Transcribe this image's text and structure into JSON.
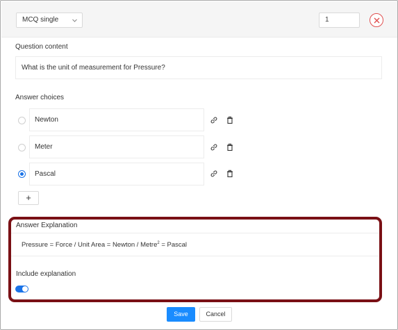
{
  "header": {
    "question_type": "MCQ single",
    "points_value": "1"
  },
  "question": {
    "label": "Question content",
    "text": "What is the unit of measurement for Pressure?"
  },
  "answers": {
    "label": "Answer choices",
    "choices": [
      {
        "text": "Newton",
        "selected": false
      },
      {
        "text": "Meter",
        "selected": false
      },
      {
        "text": "Pascal",
        "selected": true
      }
    ],
    "add_label": "+"
  },
  "explanation": {
    "label": "Answer Explanation",
    "text_before": "Pressure = Force / Unit Area = Newton / Metre",
    "superscript": "2",
    "text_after": " = Pascal",
    "include_label": "Include explanation",
    "include_enabled": true
  },
  "footer": {
    "save_label": "Save",
    "cancel_label": "Cancel"
  },
  "colors": {
    "accent": "#1a73e8",
    "save_button": "#1a8cff",
    "remove_icon": "#e05050",
    "highlight_border": "#7a1015"
  },
  "icons": {
    "type_select": "chevron-down-icon",
    "remove": "close-icon",
    "link": "link-icon",
    "delete": "trash-icon"
  }
}
